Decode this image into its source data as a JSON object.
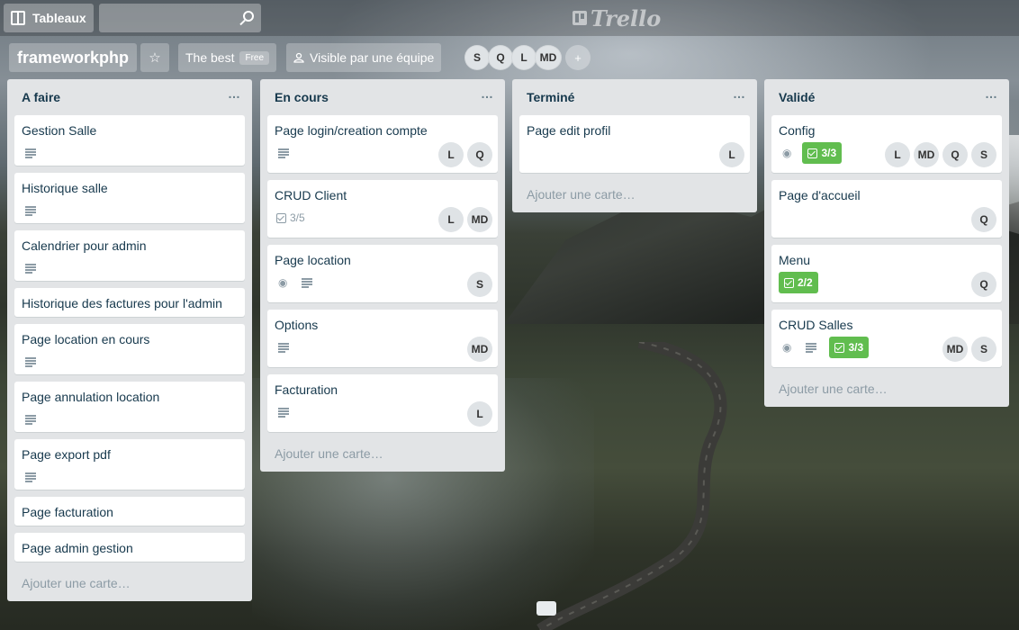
{
  "topbar": {
    "boards_label": "Tableaux",
    "search_placeholder": "",
    "logo_text": "Trello"
  },
  "board": {
    "title": "frameworkphp",
    "team_label": "The best",
    "team_badge": "Free",
    "visibility_label": "Visible par une équipe",
    "members": [
      "S",
      "Q",
      "L",
      "MD"
    ]
  },
  "lists": [
    {
      "title": "A faire",
      "add_label": "Ajouter une carte…",
      "cards": [
        {
          "title": "Gestion Salle"
        },
        {
          "title": "Historique salle"
        },
        {
          "title": "Calendrier pour admin"
        },
        {
          "title": "Historique des factures pour l'admin"
        },
        {
          "title": "Page location en cours"
        },
        {
          "title": "Page annulation location"
        },
        {
          "title": "Page export pdf"
        },
        {
          "title": "Page facturation"
        },
        {
          "title": "Page admin gestion"
        }
      ]
    },
    {
      "title": "En cours",
      "add_label": "Ajouter une carte…",
      "cards": [
        {
          "title": "Page login/creation compte",
          "members": [
            "L",
            "Q"
          ]
        },
        {
          "title": "CRUD Client",
          "checklist": "3/5",
          "members": [
            "L",
            "MD"
          ]
        },
        {
          "title": "Page location",
          "members": [
            "S"
          ]
        },
        {
          "title": "Options",
          "members": [
            "MD"
          ]
        },
        {
          "title": "Facturation",
          "members": [
            "L"
          ]
        }
      ]
    },
    {
      "title": "Terminé",
      "add_label": "Ajouter une carte…",
      "cards": [
        {
          "title": "Page edit profil",
          "members": [
            "L"
          ]
        }
      ]
    },
    {
      "title": "Validé",
      "add_label": "Ajouter une carte…",
      "cards": [
        {
          "title": "Config",
          "checklist": "3/3",
          "members": [
            "L",
            "MD",
            "Q",
            "S"
          ]
        },
        {
          "title": "Page d'accueil",
          "members": [
            "Q"
          ]
        },
        {
          "title": "Menu",
          "checklist": "2/2",
          "members": [
            "Q"
          ]
        },
        {
          "title": "CRUD Salles",
          "checklist": "3/3",
          "members": [
            "MD",
            "S"
          ]
        }
      ]
    }
  ],
  "colors": {
    "list_bg": "#e2e4e6",
    "card_text": "#17394d",
    "checklist_done": "#61bd4f",
    "muted": "#8c9ba5"
  },
  "icons": {
    "list_menu": "…",
    "star": "☆",
    "eye": "◉",
    "add_member": "+"
  }
}
